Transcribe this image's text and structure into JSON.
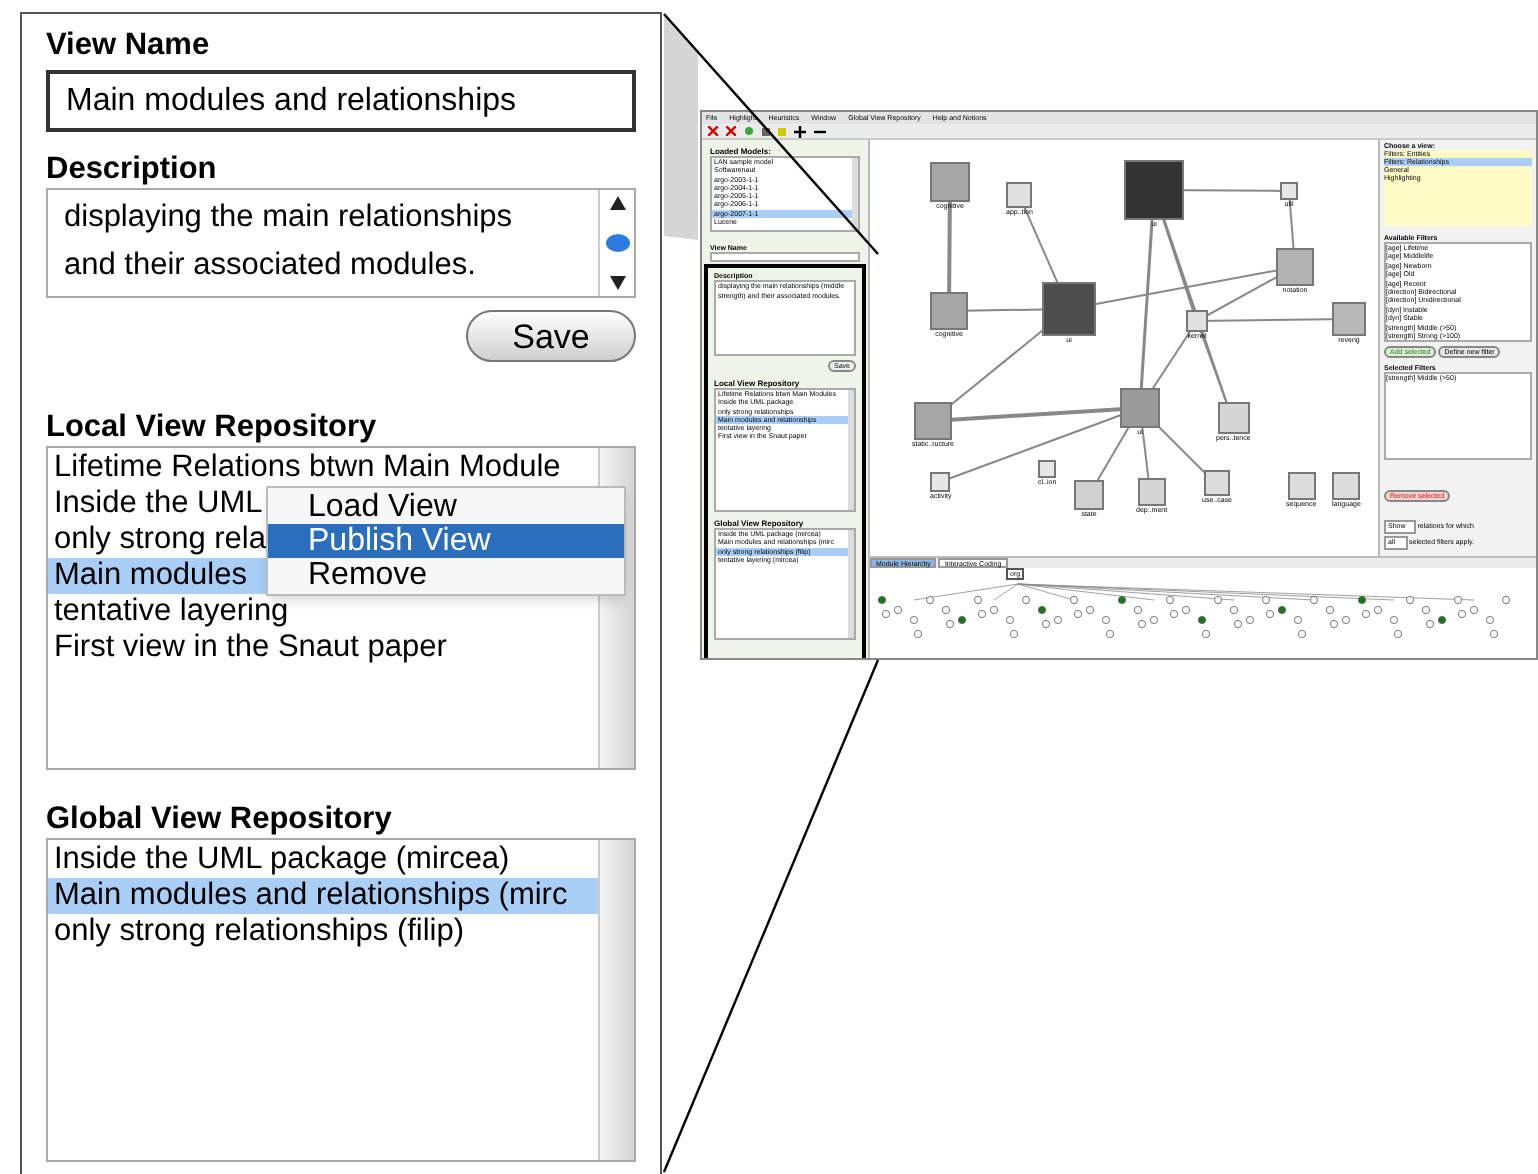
{
  "detail_panel": {
    "view_name": {
      "label": "View Name",
      "value": "Main modules and relationships"
    },
    "description": {
      "label": "Description",
      "value": "displaying the main relationships and their associated modules."
    },
    "save_button": "Save",
    "local_repository": {
      "label": "Local View Repository",
      "items": [
        {
          "text": "Lifetime Relations btwn Main Module",
          "selected": false
        },
        {
          "text": "Inside the UML",
          "selected": false
        },
        {
          "text": "only strong rela",
          "selected": false
        },
        {
          "text": "Main modules",
          "selected": true
        },
        {
          "text": "tentative layering",
          "selected": false
        },
        {
          "text": "First view in the Snaut paper",
          "selected": false
        }
      ]
    },
    "context_menu": [
      {
        "label": "Load View",
        "selected": false
      },
      {
        "label": "Publish View",
        "selected": true
      },
      {
        "label": "Remove",
        "selected": false
      }
    ],
    "global_repository": {
      "label": "Global View Repository",
      "items": [
        {
          "text": "Inside the UML package (mircea)",
          "selected": false
        },
        {
          "text": "Main modules and relationships (mirc",
          "selected": true
        },
        {
          "text": "only strong relationships (filip)",
          "selected": false
        }
      ]
    }
  },
  "app_screenshot": {
    "menu": [
      "File",
      "Highlight",
      "Heuristics",
      "Window",
      "Global View Repository",
      "Help and Notions"
    ],
    "sidebar": {
      "loaded_models": {
        "label": "Loaded Models:",
        "items": [
          {
            "text": "LAN sample model",
            "selected": false
          },
          {
            "text": "Softwarenaut",
            "selected": false
          },
          {
            "text": "argo-2003-1-1",
            "selected": false
          },
          {
            "text": "argo-2004-1-1",
            "selected": false
          },
          {
            "text": "argo-2005-1-1",
            "selected": false
          },
          {
            "text": "argo-2006-1-1",
            "selected": false
          },
          {
            "text": "argo-2007-1-1",
            "selected": true
          },
          {
            "text": "Lucene",
            "selected": false
          }
        ]
      },
      "view_name_label": "View Name",
      "description": {
        "label": "Description",
        "value": "displaying the main relationships (middle strength) and their associated modules."
      },
      "save_button": "Save",
      "local_repository": {
        "label": "Local View Repository",
        "items": [
          {
            "text": "Lifetime Relations btwn Main Modules",
            "selected": false
          },
          {
            "text": "Inside the UML package",
            "selected": false
          },
          {
            "text": "only strong relationships",
            "selected": false
          },
          {
            "text": "Main modules and relationships",
            "selected": true
          },
          {
            "text": "tentative layering",
            "selected": false
          },
          {
            "text": "First view in the Snaut paper",
            "selected": false
          }
        ]
      },
      "global_repository": {
        "label": "Global View Repository",
        "items": [
          {
            "text": "Inside the UML package (mircea)",
            "selected": false
          },
          {
            "text": "Main modules and relationships (mirc",
            "selected": false
          },
          {
            "text": "only strong relationships (filip)",
            "selected": true
          },
          {
            "text": "tentative layering (mircea)",
            "selected": false
          }
        ]
      }
    },
    "graph_nodes": [
      {
        "label": "cognitive",
        "color": "#a6a6a6"
      },
      {
        "label": "app..tion",
        "color": "#e0e0e0"
      },
      {
        "label": "ui",
        "color": "#333333"
      },
      {
        "label": "util",
        "color": "#e6e6e6"
      },
      {
        "label": "cognitive",
        "color": "#a6a6a6"
      },
      {
        "label": "ui",
        "color": "#4d4d4d"
      },
      {
        "label": "notation",
        "color": "#b3b3b3"
      },
      {
        "label": "kernel",
        "color": "#e0e0e0"
      },
      {
        "label": "reveng",
        "color": "#b8b8b8"
      },
      {
        "label": "static..ructure",
        "color": "#a6a6a6"
      },
      {
        "label": "ui",
        "color": "#9a9a9a"
      },
      {
        "label": "pers..tence",
        "color": "#d6d6d6"
      },
      {
        "label": "activity",
        "color": "#e6e6e6"
      },
      {
        "label": "cl..ion",
        "color": "#e6e6e6"
      },
      {
        "label": "state",
        "color": "#d0d0d0"
      },
      {
        "label": "dep..ment",
        "color": "#d6d6d6"
      },
      {
        "label": "use..case",
        "color": "#dcdcdc"
      },
      {
        "label": "sequence",
        "color": "#dcdcdc"
      },
      {
        "label": "language",
        "color": "#dcdcdc"
      }
    ],
    "right_panel": {
      "choose_view": {
        "label": "Choose a view:",
        "items": [
          {
            "text": "Filters: Entities",
            "selected": false
          },
          {
            "text": "Filters: Relationships",
            "selected": true
          },
          {
            "text": "General",
            "selected": false
          },
          {
            "text": "Highlighting",
            "selected": false
          }
        ]
      },
      "available_filters": {
        "label": "Available Filters",
        "items": [
          "[age] Lifetime",
          "[age] Middlelife",
          "[age] Newborn",
          "[age] Old",
          "[age] Recent",
          "[direction] Bidirectional",
          "[direction] Unidirectional",
          "[dyn] Instable",
          "[dyn] Stable",
          "[strength] Middle (>50)",
          "[strength] Strong (>100)"
        ]
      },
      "add_button": "Add selected",
      "define_button": "Define new filter",
      "selected_filters": {
        "label": "Selected Filters",
        "items": [
          "[strength] Middle (>50)"
        ]
      },
      "remove_button": "Remove selected",
      "show_select": "Show",
      "show_text": "relations for which",
      "all_select": "all",
      "all_text": "selected filters apply."
    },
    "bottom_tabs": [
      {
        "label": "Module Hierarchy",
        "selected": true
      },
      {
        "label": "Interactive Coding",
        "selected": false
      }
    ],
    "tree_root": "org"
  }
}
